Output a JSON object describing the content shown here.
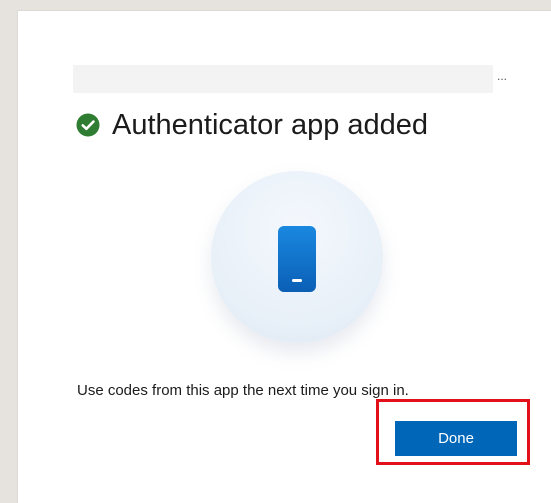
{
  "dialog": {
    "identity_ellipsis": "...",
    "title": "Authenticator app added",
    "title_icon": "check-circle-icon",
    "illustration_icon": "phone-icon",
    "body": "Use codes from this app the next time you sign in.",
    "done_label": "Done"
  },
  "colors": {
    "success": "#2e8b3f",
    "primary": "#0067b8",
    "highlight": "#e3101a"
  }
}
